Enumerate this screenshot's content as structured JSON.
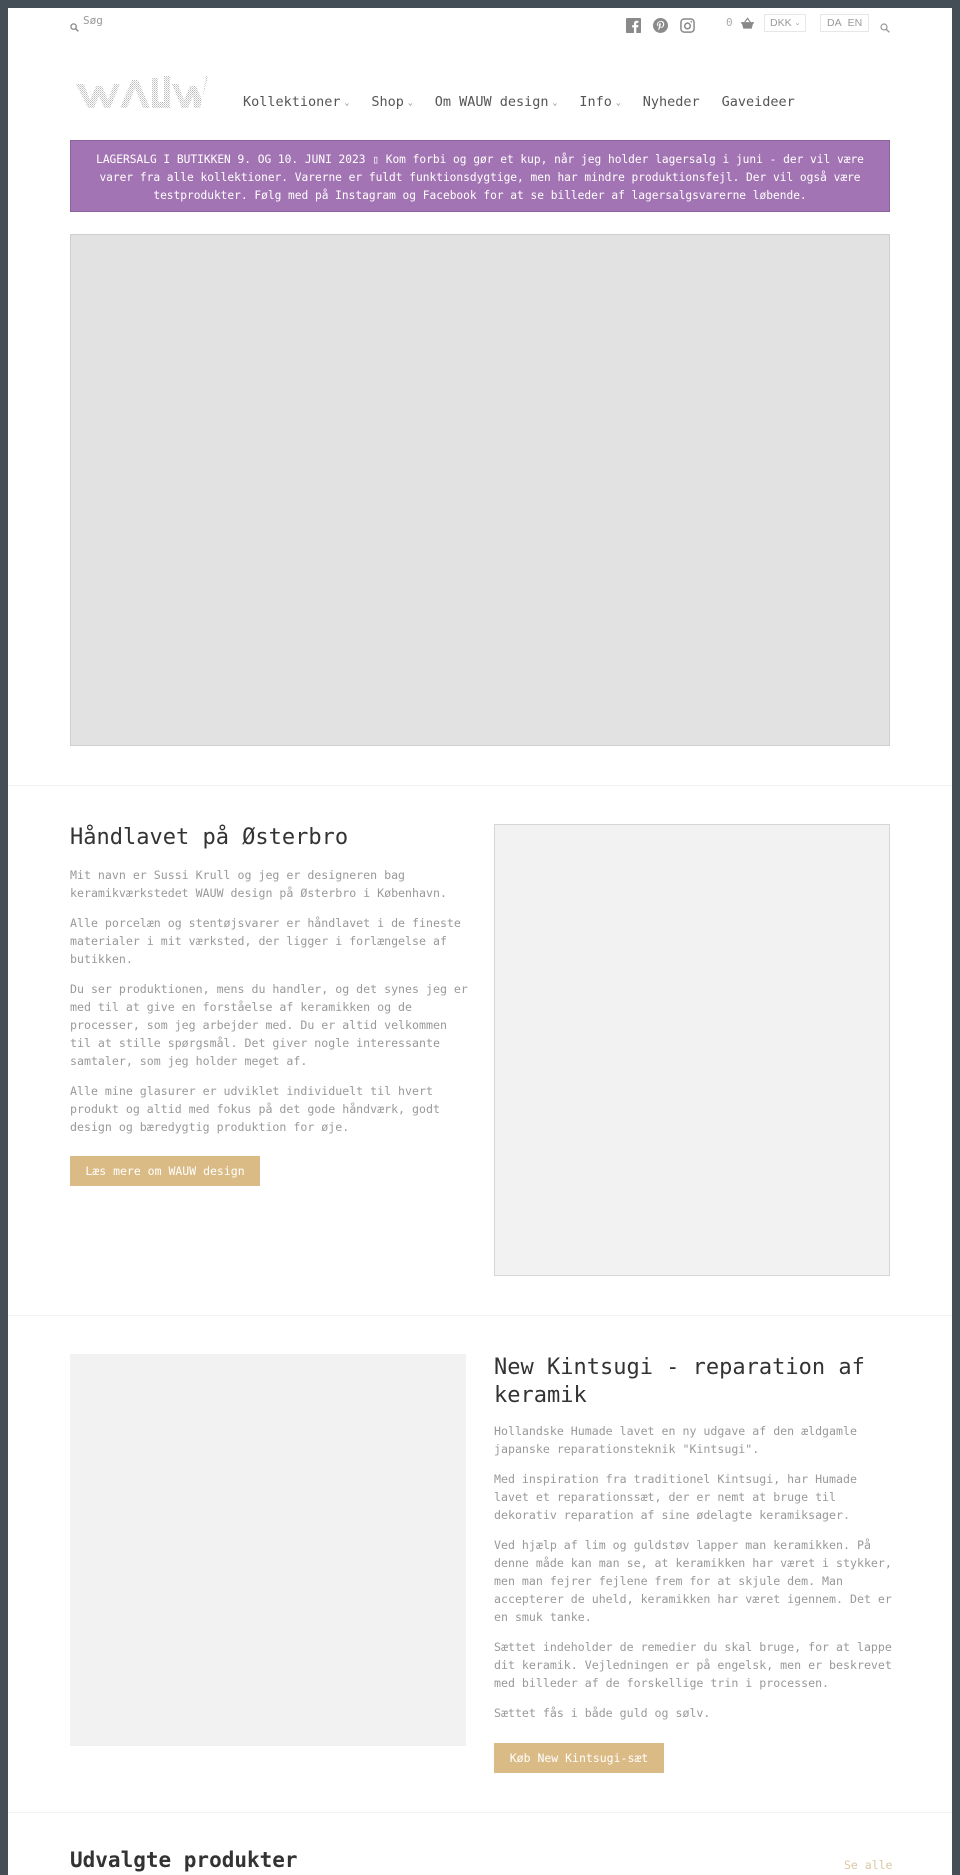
{
  "header": {
    "search_label": "Søg",
    "social": [
      {
        "name": "facebook-icon"
      },
      {
        "name": "pinterest-icon"
      },
      {
        "name": "instagram-icon"
      }
    ],
    "cart_count": "0",
    "currency": "DKK",
    "languages": [
      "DA",
      "EN"
    ],
    "logo_text": "WAUW"
  },
  "nav": {
    "items": [
      {
        "label": "Kollektioner",
        "has_dropdown": true
      },
      {
        "label": "Shop",
        "has_dropdown": true
      },
      {
        "label": "Om WAUW design",
        "has_dropdown": true
      },
      {
        "label": "Info",
        "has_dropdown": true
      },
      {
        "label": "Nyheder",
        "has_dropdown": false
      },
      {
        "label": "Gaveideer",
        "has_dropdown": false
      }
    ]
  },
  "announcement": {
    "text": "LAGERSALG I BUTIKKEN 9. OG 10. JUNI 2023 ▯ Kom forbi og gør et kup, når jeg holder lagersalg i juni - der vil være varer fra alle kollektioner. Varerne er fuldt funktionsdygtige, men har mindre produktionsfejl. Der vil også være testprodukter. Følg med på Instagram og Facebook for at se billeder af lagersalgsvarerne løbende.",
    "background": "#a374b3"
  },
  "section_about": {
    "title": "Håndlavet på Østerbro",
    "paragraphs": [
      "Mit navn er Sussi Krull og jeg er designeren bag keramikværkstedet WAUW design på Østerbro i København.",
      "Alle porcelæn og stentøjsvarer er håndlavet i de fineste materialer i mit værksted, der ligger i forlængelse af butikken.",
      "Du ser produktionen, mens du handler, og det synes jeg er med til at give en forståelse af keramikken og de processer, som jeg arbejder med. Du er altid velkommen til at stille spørgsmål. Det giver nogle interessante samtaler, som jeg holder meget af.",
      "Alle mine glasurer er udviklet individuelt til hvert produkt og altid med fokus på det gode håndværk, godt design og bæredygtig produktion for øje."
    ],
    "button_label": "Læs mere om WAUW design"
  },
  "section_kintsugi": {
    "title": "New Kintsugi - reparation af keramik",
    "paragraphs": [
      "Hollandske Humade lavet en ny udgave af den ældgamle japanske reparationsteknik \"Kintsugi\".",
      "Med inspiration fra traditionel Kintsugi, har Humade lavet et reparationssæt, der er nemt at bruge til dekorativ reparation af sine ødelagte keramiksager.",
      "Ved hjælp af lim og guldstøv lapper man keramikken. På denne måde kan man se, at keramikken har været i stykker, men man fejrer fejlene frem for at skjule dem. Man accepterer de uheld, keramikken har været igennem. Det er en smuk tanke.",
      "Sættet indeholder de remedier du skal bruge, for at lappe dit keramik. Vejledningen er på engelsk, men er beskrevet med billeder af de forskellige trin i processen.",
      "Sættet fås i både guld og sølv."
    ],
    "button_label": "Køb New Kintsugi-sæt"
  },
  "featured": {
    "title": "Udvalgte produkter",
    "see_all_label": "Se alle"
  },
  "colors": {
    "accent_button": "#dbbb85",
    "frame": "#434e56"
  }
}
